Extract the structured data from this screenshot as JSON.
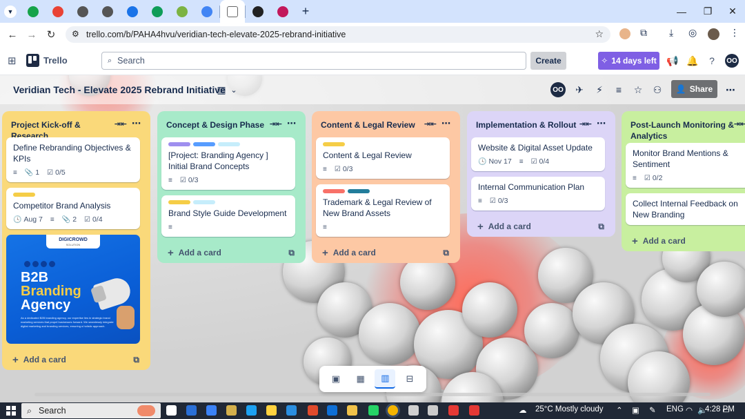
{
  "browser": {
    "url": "trello.com/b/PAHA4hvu/veridian-tech-elevate-2025-rebrand-initiative",
    "tab_colors": [
      "#17a34a",
      "#e94235",
      "#555555",
      "#555555",
      "#1a73e8",
      "#0f9d58",
      "#7cb342",
      "#4285f4",
      "#ffffff",
      "#222222",
      "#c2185b"
    ],
    "tab_icons": [
      "frontlines-icon",
      "drive-icon",
      "site-icon",
      "apple-icon",
      "circle-icon",
      "cube-icon",
      "gemini-star-icon",
      "gemini-icon",
      "trello-tab-icon",
      "openai-icon",
      "grammarly-icon"
    ],
    "new_tab": "+",
    "win_min": "—",
    "win_max": "❐",
    "win_close": "✕"
  },
  "header": {
    "app_name": "Trello",
    "search_placeholder": "Search",
    "create_label": "Create",
    "trial_label": "14 days left",
    "avatar_initials": "OO"
  },
  "board": {
    "title": "Veridian Tech - Elevate 2025 Rebrand Initiative",
    "share_label": "Share",
    "member_initials": "OO"
  },
  "lists": [
    {
      "title": "Project Kick-off & Research",
      "color": "#fad97a",
      "cards": [
        {
          "title": "Define Rebranding Objectives & KPIs",
          "labels": [],
          "badges": [
            {
              "icon": "description",
              "text": ""
            },
            {
              "icon": "attachment",
              "text": "1"
            },
            {
              "icon": "checklist",
              "text": "0/5"
            }
          ]
        },
        {
          "title": "Competitor Brand Analysis",
          "labels": [
            "#f5cd47"
          ],
          "badges": [
            {
              "icon": "clock",
              "text": "Aug 7"
            },
            {
              "icon": "description",
              "text": ""
            },
            {
              "icon": "attachment",
              "text": "2"
            },
            {
              "icon": "checklist",
              "text": "0/4"
            }
          ]
        }
      ],
      "ad": {
        "brand": "DIGICROWD",
        "brand_sub": "SOLUTION",
        "line1": "B2B",
        "line2": "Branding",
        "line3": "Agency",
        "body": "As a dedicated B2B branding agency, our expertise lies in strategic brand marketing services that propel businesses forward. We seamlessly integrate digital marketing and branding services, ensuring a holistic approach."
      },
      "add_card": "Add a card"
    },
    {
      "title": "Concept & Design Phase",
      "color": "#a7eac9",
      "cards": [
        {
          "title": "[Project: Branding Agency ] Initial Brand Concepts",
          "labels": [
            "#9f8fef",
            "#579dff",
            "#c6edfb"
          ],
          "badges": [
            {
              "icon": "description",
              "text": ""
            },
            {
              "icon": "checklist",
              "text": "0/3"
            }
          ]
        },
        {
          "title": "Brand Style Guide Development",
          "labels": [
            "#f5cd47",
            "#c6edfb"
          ],
          "badges": [
            {
              "icon": "description",
              "text": ""
            }
          ]
        }
      ],
      "add_card": "Add a card"
    },
    {
      "title": "Content & Legal Review",
      "color": "#fdc8a4",
      "cards": [
        {
          "title": "Content & Legal Review",
          "labels": [
            "#f5cd47"
          ],
          "badges": [
            {
              "icon": "description",
              "text": ""
            },
            {
              "icon": "checklist",
              "text": "0/3"
            }
          ]
        },
        {
          "title": "Trademark & Legal Review of New Brand Assets",
          "labels": [
            "#f87168",
            "#227d9b"
          ],
          "badges": [
            {
              "icon": "description",
              "text": ""
            }
          ]
        }
      ],
      "add_card": "Add a card"
    },
    {
      "title": "Implementation & Rollout",
      "color": "#dcd5f7",
      "cards": [
        {
          "title": "Website & Digital Asset Update",
          "labels": [],
          "badges": [
            {
              "icon": "clock",
              "text": "Nov 17"
            },
            {
              "icon": "description",
              "text": ""
            },
            {
              "icon": "checklist",
              "text": "0/4"
            }
          ]
        },
        {
          "title": "Internal Communication Plan",
          "labels": [],
          "badges": [
            {
              "icon": "description",
              "text": ""
            },
            {
              "icon": "checklist",
              "text": "0/3"
            }
          ]
        }
      ],
      "add_card": "Add a card"
    },
    {
      "title": "Post-Launch Monitoring & Analytics",
      "color": "#c8ef9f",
      "cards": [
        {
          "title": "Monitor Brand Mentions & Sentiment",
          "labels": [],
          "badges": [
            {
              "icon": "description",
              "text": ""
            },
            {
              "icon": "checklist",
              "text": "0/2"
            }
          ]
        },
        {
          "title": "Collect Internal Feedback on New Branding",
          "labels": [],
          "badges": []
        }
      ],
      "add_card": "Add a card"
    }
  ],
  "views": [
    "inbox-view",
    "calendar-view",
    "board-view",
    "switch-boards"
  ],
  "taskbar": {
    "search_placeholder": "Search",
    "weather": "25°C  Mostly cloudy",
    "language": "ENG",
    "time": "4:28 PM"
  }
}
